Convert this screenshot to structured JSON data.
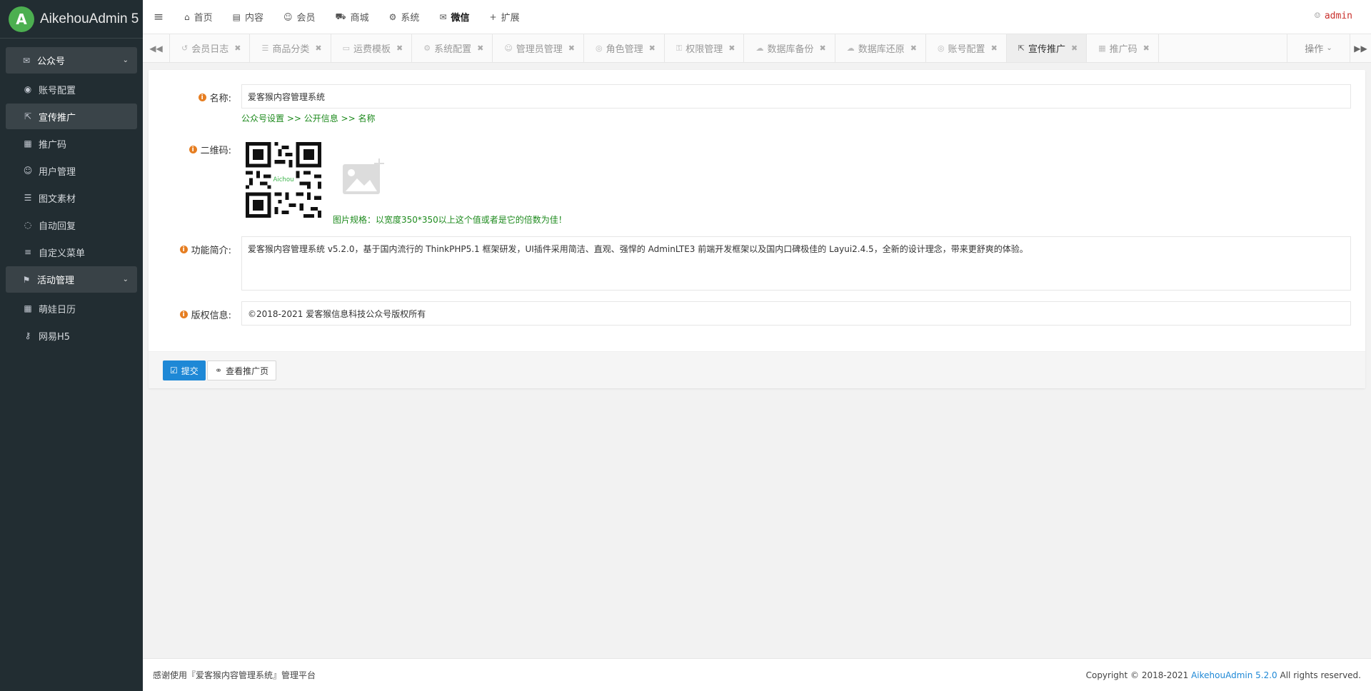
{
  "brand": {
    "logo": "A",
    "name": "AikehouAdmin 5"
  },
  "sidebar": {
    "groups": [
      {
        "label": "公众号",
        "icon": "wechat-icon",
        "items": [
          {
            "label": "账号配置",
            "icon": "user-circle-icon"
          },
          {
            "label": "宣传推广",
            "icon": "external-link-icon",
            "active": true
          },
          {
            "label": "推广码",
            "icon": "qrcode-icon"
          },
          {
            "label": "用户管理",
            "icon": "users-icon"
          },
          {
            "label": "图文素材",
            "icon": "list-icon"
          },
          {
            "label": "自动回复",
            "icon": "comment-icon"
          },
          {
            "label": "自定义菜单",
            "icon": "bars-icon"
          }
        ]
      },
      {
        "label": "活动管理",
        "icon": "flag-icon",
        "items": [
          {
            "label": "萌娃日历",
            "icon": "calendar-icon"
          },
          {
            "label": "网易H5",
            "icon": "key-icon"
          }
        ]
      }
    ]
  },
  "topmenu": {
    "items": [
      {
        "label": "首页",
        "glyph": "⌂"
      },
      {
        "label": "内容",
        "glyph": "▤"
      },
      {
        "label": "会员",
        "glyph": "☺"
      },
      {
        "label": "商城",
        "glyph": "⛟"
      },
      {
        "label": "系统",
        "glyph": "⚙"
      },
      {
        "label": "微信",
        "glyph": "✉",
        "active": true
      },
      {
        "label": "扩展",
        "glyph": "+"
      }
    ],
    "user": "admin"
  },
  "tabs": {
    "items": [
      {
        "label": "会员日志",
        "glyph": "↺"
      },
      {
        "label": "商品分类",
        "glyph": "☰"
      },
      {
        "label": "运费模板",
        "glyph": "▭"
      },
      {
        "label": "系统配置",
        "glyph": "⚙"
      },
      {
        "label": "管理员管理",
        "glyph": "☺"
      },
      {
        "label": "角色管理",
        "glyph": "◎"
      },
      {
        "label": "权限管理",
        "glyph": "⚿"
      },
      {
        "label": "数据库备份",
        "glyph": "☁"
      },
      {
        "label": "数据库还原",
        "glyph": "☁"
      },
      {
        "label": "账号配置",
        "glyph": "◎"
      },
      {
        "label": "宣传推广",
        "glyph": "⇱",
        "active": true
      },
      {
        "label": "推广码",
        "glyph": "▦"
      }
    ],
    "ops_label": "操作"
  },
  "form": {
    "name_label": "名称:",
    "name_value": "爱客猴内容管理系统",
    "name_hint": "公众号设置 >> 公开信息 >> 名称",
    "qr_label": "二维码:",
    "qr_text": "Aichou",
    "qr_hint": "图片规格：以宽度350*350以上这个值或者是它的倍数为佳！",
    "desc_label": "功能简介:",
    "desc_value": "爱客猴内容管理系统 v5.2.0，基于国内流行的 ThinkPHP5.1 框架研发，UI插件采用简洁、直观、强悍的 AdminLTE3 前端开发框架以及国内口碑极佳的 Layui2.4.5，全新的设计理念，带来更舒爽的体验。",
    "copyright_label": "版权信息:",
    "copyright_value": "©2018-2021 爱客猴信息科技公众号版权所有",
    "submit_label": "提交",
    "view_label": "查看推广页"
  },
  "footer": {
    "left": "感谢使用『爱客猴内容管理系统』管理平台",
    "right_prefix": "Copyright © 2018-2021 ",
    "right_link": "AikehouAdmin 5.2.0",
    "right_suffix": " All rights reserved."
  }
}
